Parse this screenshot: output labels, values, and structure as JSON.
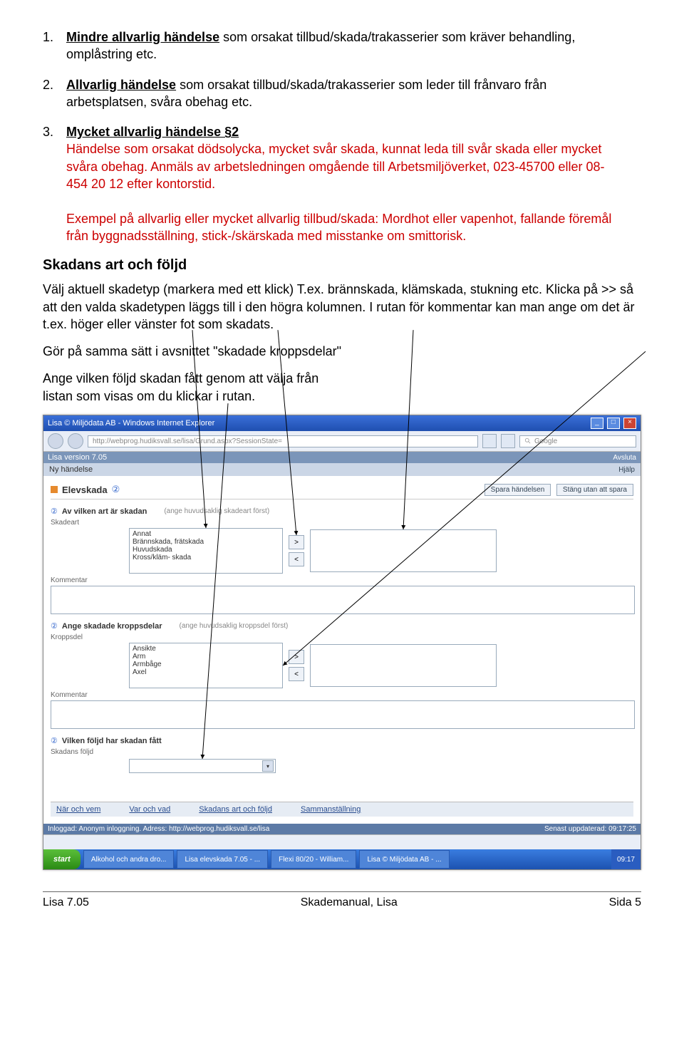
{
  "list": {
    "n1": "1.",
    "item1_bold": "Mindre allvarlig händelse",
    "item1_rest": " som orsakat tillbud/skada/trakasserier som kräver behandling, omplåstring etc.",
    "n2": "2.",
    "item2_bold": "Allvarlig händelse",
    "item2_rest": " som orsakat tillbud/skada/trakasserier som leder till frånvaro från arbetsplatsen, svåra obehag etc.",
    "n3": "3.",
    "item3_bold": "Mycket allvarlig händelse §2",
    "item3_red1": "Händelse som orsakat dödsolycka, mycket svår skada, kunnat leda till svår skada eller mycket svåra obehag. Anmäls av arbetsledningen omgående till Arbetsmiljöverket, 023-45700 eller 08-454 20 12 efter kontorstid.",
    "item3_red2": "Exempel på allvarlig eller mycket allvarlig tillbud/skada: Mordhot eller vapenhot, fallande föremål från byggnadsställning, stick-/skärskada med misstanke om smittorisk."
  },
  "h2": "Skadans art och följd",
  "p1": "Välj aktuell skadetyp (markera med ett klick) T.ex. brännskada, klämskada, stukning etc. Klicka på >> så att den valda skadetypen läggs till i den högra kolumnen. I rutan för kommentar kan man ange om det är t.ex. höger eller vänster fot som skadats.",
  "p2": "Gör på samma sätt i avsnittet \"skadade kroppsdelar\"",
  "p3": "Ange vilken följd skadan fått genom att välja från listan som visas om du klickar i rutan.",
  "ie": {
    "title": "Lisa © Miljödata AB - Windows Internet Explorer",
    "url": "http://webprog.hudiksvall.se/lisa/Grund.aspx?SessionState=",
    "search_placeholder": "Google"
  },
  "app": {
    "ver": "Lisa version 7.05",
    "tab": "Ny händelse",
    "avsluta": "Avsluta",
    "hjalp": "Hjälp"
  },
  "form": {
    "title": "Elevskada",
    "spara": "Spara händelsen",
    "stang": "Stäng utan att spara",
    "q1": "Av vilken art är skadan",
    "q1_hint": "(ange huvudsaklig skadeart först)",
    "skadeart_label": "Skadeart",
    "skadeart_items": [
      "Annat",
      "Brännskada, frätskada",
      "Huvudskada",
      "Kross/kläm- skada"
    ],
    "kommentar_label": "Kommentar",
    "q2": "Ange skadade kroppsdelar",
    "q2_hint": "(ange huvudsaklig kroppsdel först)",
    "kroppsdel_label": "Kroppsdel",
    "kroppsdel_items": [
      "Ansikte",
      "Arm",
      "Armbåge",
      "Axel"
    ],
    "q3": "Vilken följd har skadan fått",
    "foljd_label": "Skadans följd",
    "move_add": ">",
    "move_rem": "<"
  },
  "tabs": {
    "t1": "När och vem",
    "t2": "Var och vad",
    "t3": "Skadans art och följd",
    "t4": "Sammanställning"
  },
  "status": {
    "left": "Inloggad: Anonym inloggning. Adress: http://webprog.hudiksvall.se/lisa",
    "right": "Senast uppdaterad: 09:17:25"
  },
  "taskbar": {
    "start": "start",
    "i1": "Alkohol och andra dro...",
    "i2": "Lisa elevskada 7.05 - ...",
    "i3": "Flexi 80/20 - William...",
    "i4": "Lisa © Miljödata AB - ...",
    "time": "09:17"
  },
  "footer": {
    "left": "Lisa 7.05",
    "center": "Skademanual, Lisa",
    "right": "Sida 5"
  }
}
